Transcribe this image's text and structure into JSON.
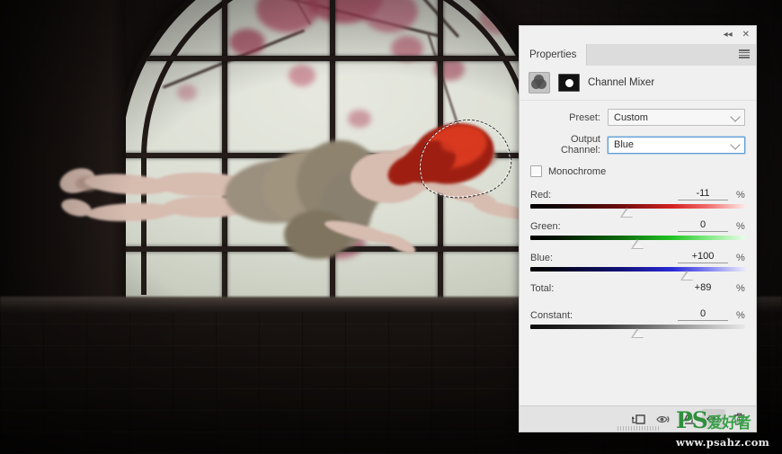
{
  "app": {
    "document_title": "Channel Mixer adjustment in Photoshop Properties panel"
  },
  "panel": {
    "tab_label": "Properties",
    "collapse_icon": "◂◂",
    "close_icon": "✕",
    "menu_icon": "panel-menu-icon",
    "adjustment_title": "Channel Mixer",
    "adjustment_icon": "channel-mixer-icon",
    "mask_thumbnail": "layer-mask-thumbnail"
  },
  "form": {
    "preset_label": "Preset:",
    "preset_value": "Custom",
    "output_channel_label": "Output Channel:",
    "output_channel_value": "Blue",
    "monochrome_label": "Monochrome",
    "monochrome_checked": false,
    "percent_symbol": "%"
  },
  "sliders": [
    {
      "name": "red-slider",
      "label": "Red:",
      "value": "-11",
      "percent": "%",
      "handle_pct": 45,
      "track": "tr-red"
    },
    {
      "name": "green-slider",
      "label": "Green:",
      "value": "0",
      "percent": "%",
      "handle_pct": 50,
      "track": "tr-green"
    },
    {
      "name": "blue-slider",
      "label": "Blue:",
      "value": "+100",
      "percent": "%",
      "handle_pct": 73,
      "track": "tr-blue"
    }
  ],
  "total": {
    "label": "Total:",
    "value": "+89",
    "percent": "%"
  },
  "constant": {
    "label": "Constant:",
    "value": "0",
    "percent": "%",
    "handle_pct": 50
  },
  "bottom_toolbar": [
    {
      "name": "clip-to-layer-button",
      "icon": "clip-to-layer-icon",
      "selected": false
    },
    {
      "name": "toggle-preview-button",
      "icon": "eye-arrow-icon",
      "selected": false
    },
    {
      "name": "reset-adjustment-button",
      "icon": "reset-arrow-icon",
      "selected": false
    },
    {
      "name": "toggle-visibility-button",
      "icon": "eye-icon",
      "selected": true
    },
    {
      "name": "delete-adjustment-button",
      "icon": "trash-icon",
      "selected": false
    }
  ],
  "watermark": {
    "brand": "PS",
    "brand_cn": "爱好者",
    "url": "www.psahz.com"
  },
  "canvas": {
    "description": "Dark brick interior with arched window; red-haired woman floating horizontally; marching-ants selection around her hair",
    "selection_active": true
  },
  "colors": {
    "panel_bg": "#f0f0f0",
    "panel_tabbar": "#dcdcdc",
    "focus_border": "#5b9bd5",
    "hair": "#9e1f12",
    "watermark_green": "#2f8f3d"
  }
}
